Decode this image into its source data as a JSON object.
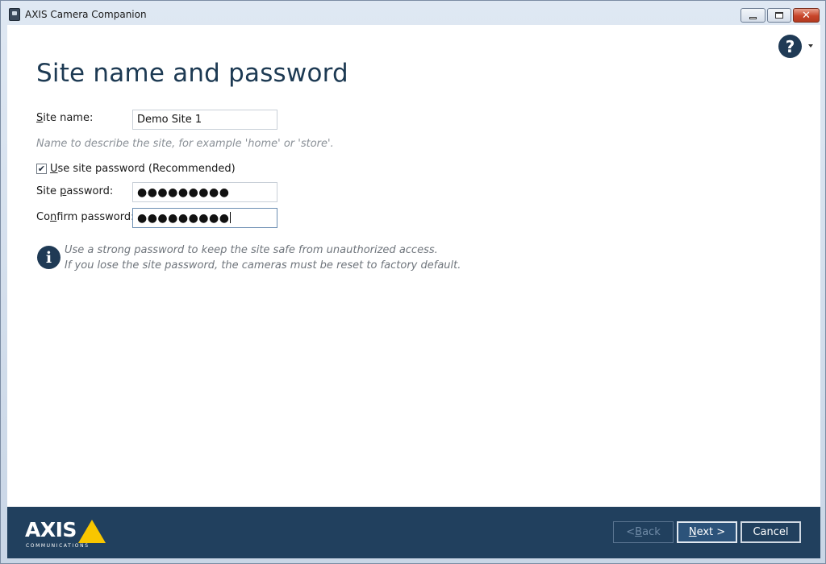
{
  "window": {
    "title": "AXIS Camera Companion",
    "close_glyph": "✕"
  },
  "help": {
    "glyph": "?"
  },
  "page": {
    "title": "Site name and password",
    "site_name": {
      "label_accel": "S",
      "label_rest": "ite name:",
      "value": "Demo Site 1",
      "hint": "Name to describe the site, for example 'home' or 'store'."
    },
    "use_password": {
      "checked": true,
      "check_glyph": "✔",
      "label_accel": "U",
      "label_rest": "se site password (Recommended)"
    },
    "site_password": {
      "label_pre": "Site ",
      "label_accel": "p",
      "label_rest": "assword:",
      "value": "●●●●●●●●●"
    },
    "confirm_password": {
      "label_pre": "Co",
      "label_accel": "n",
      "label_rest": "firm password:",
      "value": "●●●●●●●●●"
    },
    "info": {
      "glyph": "i",
      "line1": "Use a strong password to keep the site safe from unauthorized access.",
      "line2": "If you lose the site password, the cameras must be reset to factory default."
    }
  },
  "footer": {
    "logo_word": "AXIS",
    "logo_sub": "COMMUNICATIONS",
    "back": {
      "pre": "< ",
      "accel": "B",
      "rest": "ack"
    },
    "next": {
      "accel": "N",
      "rest": "ext >"
    },
    "cancel": {
      "label": "Cancel"
    }
  },
  "colors": {
    "title_blue": "#1d3a53",
    "footer_navy": "#21405e",
    "logo_yellow": "#f8c600"
  }
}
